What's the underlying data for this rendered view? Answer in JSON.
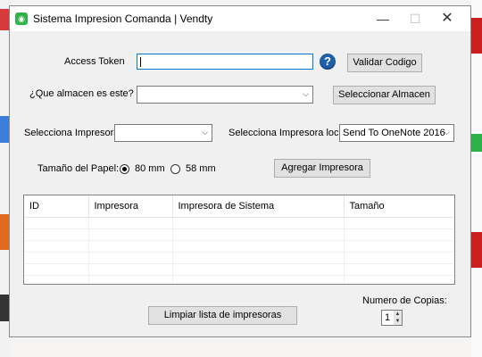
{
  "window": {
    "title": "Sistema Impresion Comanda | Vendty",
    "icon": "app-logo-icon"
  },
  "titlebar_buttons": {
    "minimize": "—",
    "maximize": "☐",
    "close": "✕"
  },
  "access_token": {
    "label": "Access Token",
    "value": "",
    "help_icon": "?",
    "validate_button": "Validar Codigo"
  },
  "almacen": {
    "label": "¿Que almacen es este?",
    "selected": "",
    "select_button": "Seleccionar Almacen"
  },
  "impresora": {
    "label": "Selecciona Impresora",
    "selected": ""
  },
  "impresora_local": {
    "label": "Selecciona Impresora local",
    "selected": "Send To OneNote 2016"
  },
  "paper": {
    "label": "Tamaño del Papel:",
    "options": [
      "80 mm",
      "58 mm"
    ],
    "selected": "80 mm"
  },
  "add_printer_button": "Agregar Impresora",
  "table": {
    "columns": [
      "ID",
      "Impresora",
      "Impresora de Sistema",
      "Tamaño"
    ],
    "rows": []
  },
  "clear_button": "Limpiar lista de impresoras",
  "copies": {
    "label": "Numero de Copias:",
    "value": "1"
  },
  "colors": {
    "accent": "#0078d7",
    "help": "#1f5fa8",
    "app_icon": "#2fb24a"
  }
}
